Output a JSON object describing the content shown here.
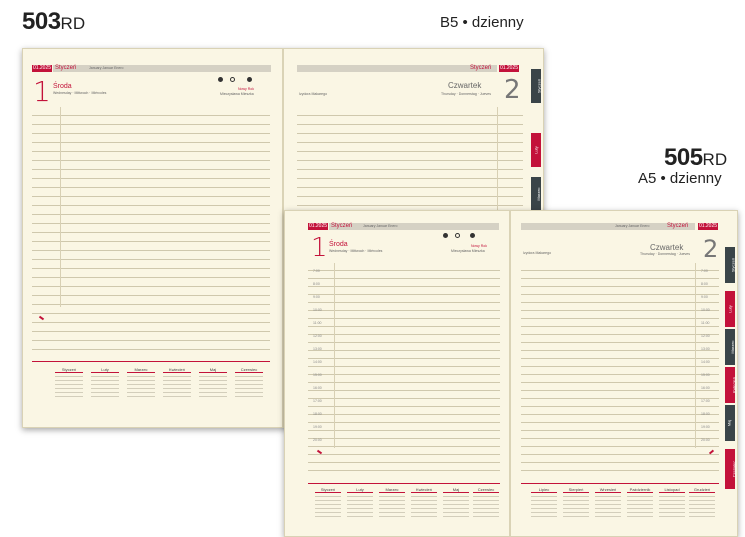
{
  "product_503": {
    "code": "503",
    "suffix": "RD",
    "format": "B5 • dzienny"
  },
  "product_505": {
    "code": "505",
    "suffix": "RD",
    "format": "A5 • dzienny"
  },
  "planner": {
    "date_chip": "01.2025",
    "month_pl": "Styczeń",
    "months_other": "January  Januar  Enero",
    "left_day_number": "1",
    "left_day_name": "Środa",
    "left_day_sub": "Wednesday · Mittwoch · Miércoles",
    "left_holiday": "Nowy Rok",
    "left_names": "Mieczysława Mieszka",
    "right_day_number": "2",
    "right_day_name": "Czwartek",
    "right_day_sub": "Thursday · Donnerstag · Jueves",
    "right_names": "Izydora Makarego",
    "hours": [
      "7:00",
      "8:00",
      "9:00",
      "10:00",
      "11:00",
      "12:00",
      "13:00",
      "14:00",
      "15:00",
      "16:00",
      "17:00",
      "18:00",
      "19:00",
      "20:00"
    ],
    "tabs": [
      "Styczeń",
      "Luty",
      "Marzec",
      "Kwiecień",
      "Maj",
      "Czerwiec"
    ],
    "mini_months_left": [
      "Styczeń",
      "Luty",
      "Marzec",
      "Kwiecień",
      "Maj",
      "Czerwiec"
    ],
    "mini_months_right": [
      "Lipiec",
      "Sierpień",
      "Wrzesień",
      "Październik",
      "Listopad",
      "Grudzień"
    ]
  },
  "colors": {
    "accent": "#c3123a",
    "paper": "#faf6e4",
    "tab_dark": "#3a4448"
  }
}
